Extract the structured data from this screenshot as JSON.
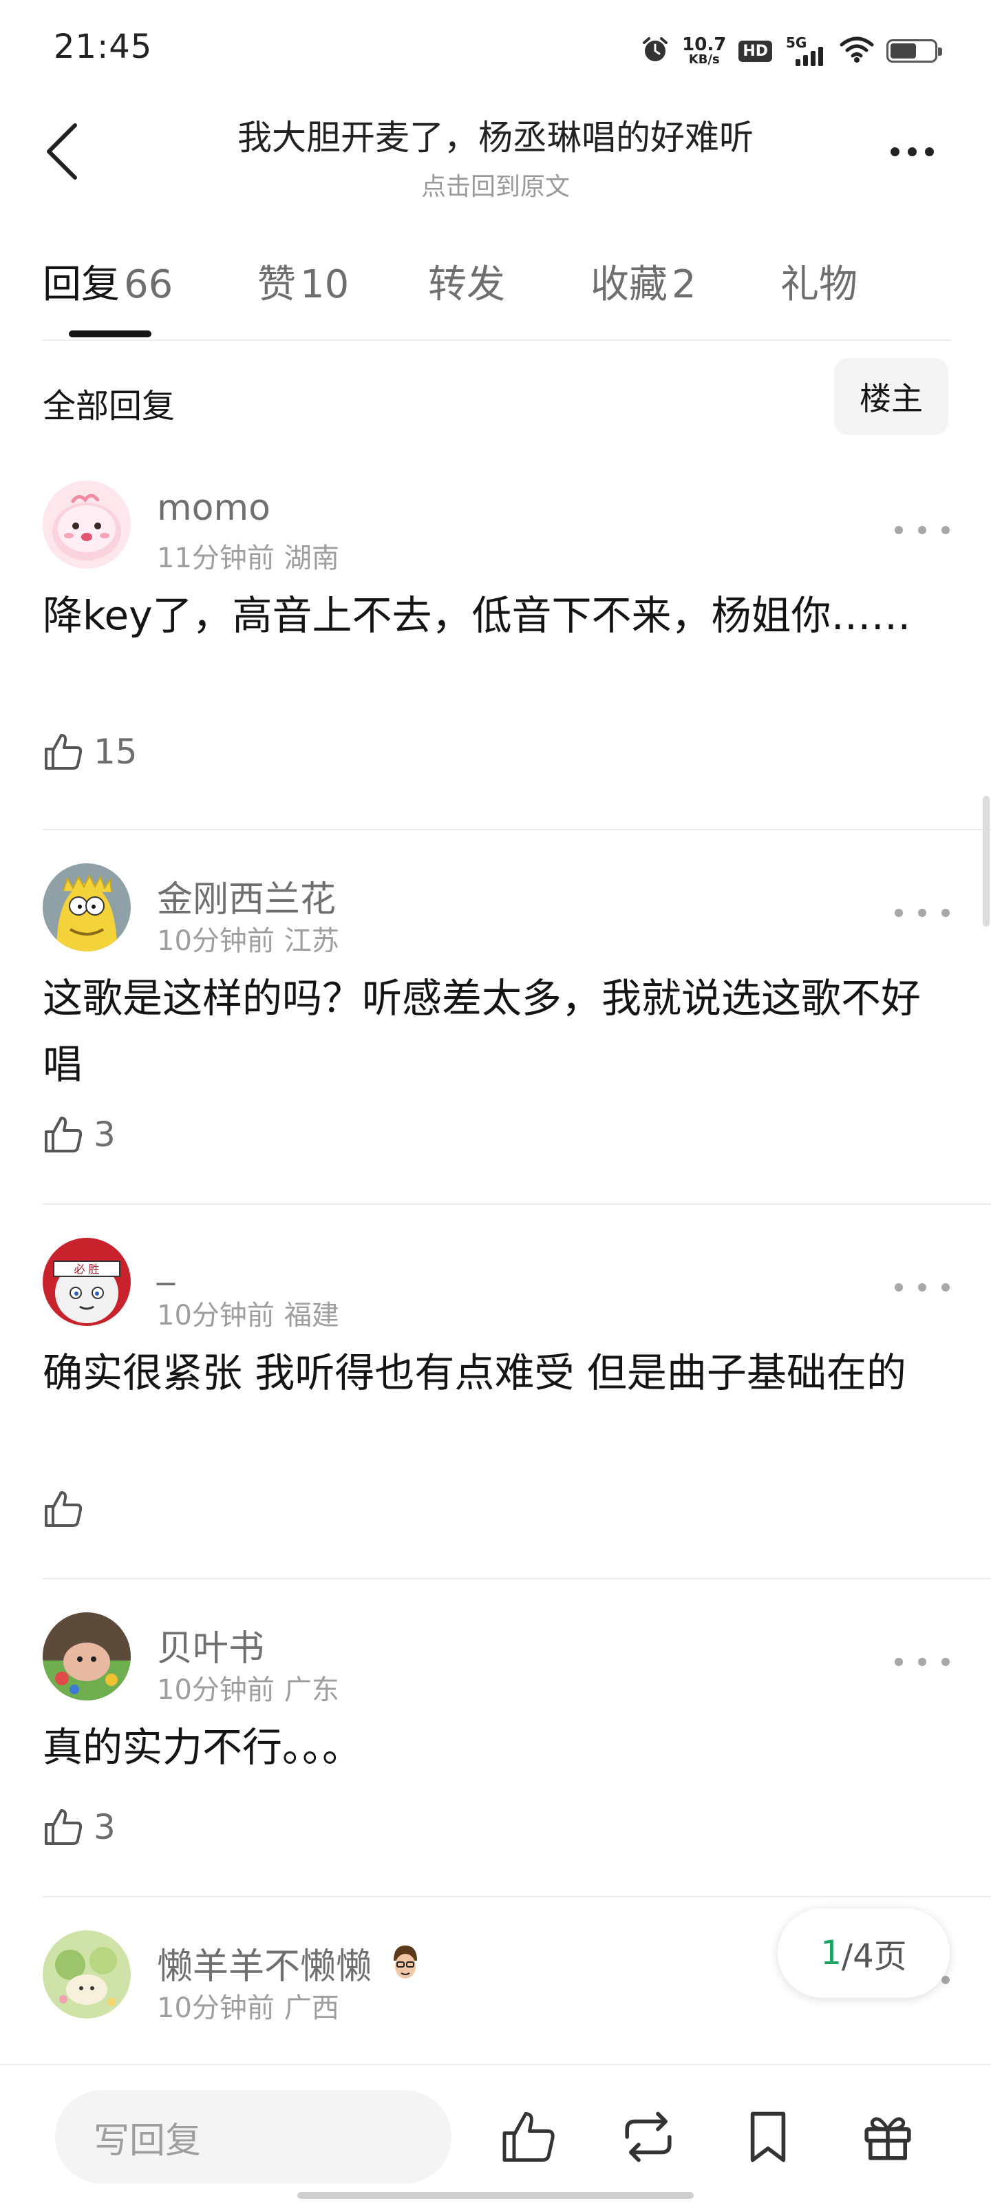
{
  "status_bar": {
    "time": "21:45",
    "speed_value": "10.7",
    "speed_unit": "KB/s",
    "hd_label": "HD",
    "network_label": "5G",
    "icons": [
      "alarm-icon",
      "speed-indicator",
      "hd-icon",
      "signal-5g-icon",
      "wifi-icon",
      "battery-icon"
    ],
    "battery_level": 0.6
  },
  "header": {
    "title": "我大胆开麦了，杨丞琳唱的好难听",
    "subtitle": "点击回到原文"
  },
  "tabs": [
    {
      "label": "回复",
      "count": "66",
      "active": true
    },
    {
      "label": "赞",
      "count": "10",
      "active": false
    },
    {
      "label": "转发",
      "count": "",
      "active": false
    },
    {
      "label": "收藏",
      "count": "2",
      "active": false
    },
    {
      "label": "礼物",
      "count": "",
      "active": false
    }
  ],
  "filter": {
    "label": "全部回复",
    "button": "楼主"
  },
  "comments": [
    {
      "username": "momo",
      "time": "11分钟前",
      "location": "湖南",
      "text": "降key了，高音上不去，低音下不来，杨姐你……",
      "likes": "15"
    },
    {
      "username": "金刚西兰花",
      "time": "10分钟前",
      "location": "江苏",
      "text": "这歌是这样的吗？听感差太多，我就说选这歌不好唱",
      "likes": "3"
    },
    {
      "username": "_",
      "time": "10分钟前",
      "location": "福建",
      "text": "确实很紧张 我听得也有点难受 但是曲子基础在的",
      "likes": ""
    },
    {
      "username": "贝叶书",
      "time": "10分钟前",
      "location": "广东",
      "text": "真的实力不行。。。",
      "likes": "3"
    },
    {
      "username": "懒羊羊不懒懒",
      "time": "10分钟前",
      "location": "广西",
      "text": "",
      "likes": ""
    }
  ],
  "pagination": {
    "current": "1",
    "total_label": "/4页"
  },
  "bottom_bar": {
    "reply_placeholder": "写回复",
    "icons": [
      "like-icon",
      "repost-icon",
      "bookmark-icon",
      "gift-icon"
    ]
  },
  "colors": {
    "accent_green": "#1aa260",
    "text_primary": "#141414",
    "text_secondary": "#6e6e6e",
    "divider": "#ececec"
  }
}
